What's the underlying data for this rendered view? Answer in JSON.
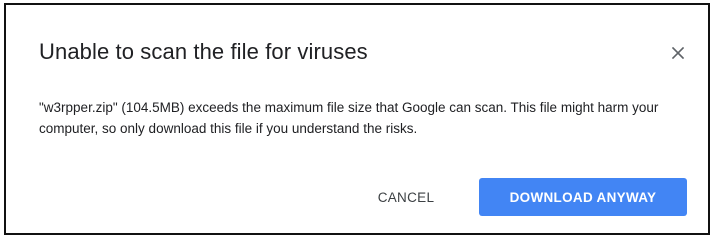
{
  "dialog": {
    "title": "Unable to scan the file for viruses",
    "message": "\"w3rpper.zip\" (104.5MB) exceeds the maximum file size that Google can scan. This file might harm your computer, so only download this file if you understand the risks.",
    "close_icon": "close-icon",
    "buttons": {
      "cancel_label": "CANCEL",
      "download_label": "DOWNLOAD ANYWAY"
    },
    "colors": {
      "primary_button": "#4285f4",
      "text": "#202124"
    }
  }
}
